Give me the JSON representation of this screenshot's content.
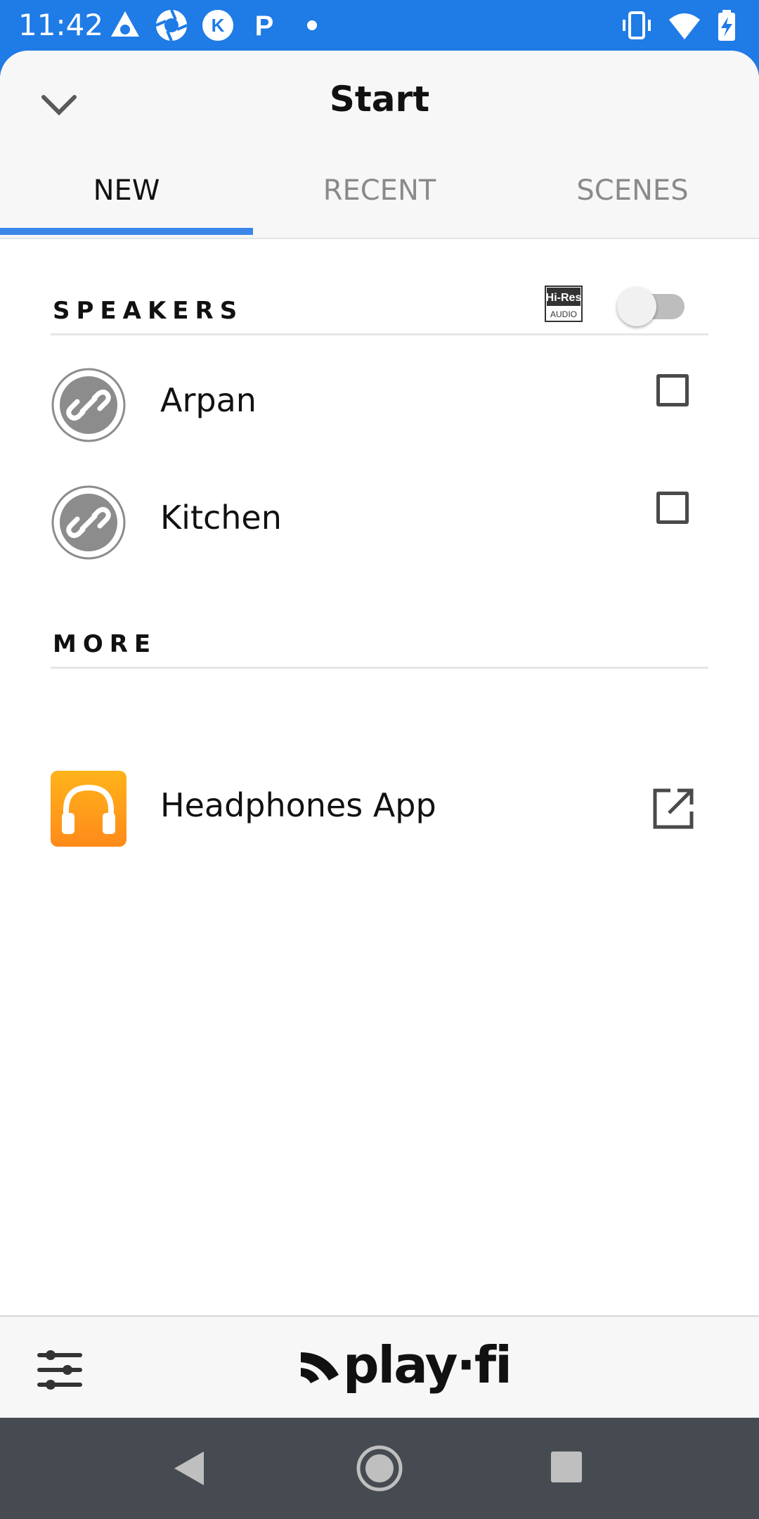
{
  "status_bar": {
    "time": "11:42",
    "left_icons": [
      "triangle-app-icon",
      "shutter-app-icon",
      "k-app-icon",
      "p-app-icon",
      "dot-notification-icon"
    ],
    "right_icons": [
      "vibrate-icon",
      "wifi-icon",
      "battery-charging-icon"
    ]
  },
  "header": {
    "title": "Start",
    "tabs": [
      {
        "label": "NEW",
        "active": true
      },
      {
        "label": "RECENT",
        "active": false
      },
      {
        "label": "SCENES",
        "active": false
      }
    ],
    "accent_color": "#3b86e8"
  },
  "speakers_section": {
    "label": "SPEAKERS",
    "hires_badge": {
      "line1": "Hi-Res",
      "line2": "AUDIO"
    },
    "hires_toggle_on": false,
    "items": [
      {
        "name": "Arpan",
        "checked": false,
        "icon": "link-icon"
      },
      {
        "name": "Kitchen",
        "checked": false,
        "icon": "link-icon"
      }
    ]
  },
  "more_section": {
    "label": "MORE",
    "items": [
      {
        "name": "Headphones App",
        "icon": "headphones-icon",
        "action_icon": "open-external-icon"
      }
    ]
  },
  "footer": {
    "logo_text": "play·fi",
    "settings_icon": "sliders-icon"
  },
  "nav_bar": {
    "buttons": [
      "back-icon",
      "home-icon",
      "recents-icon"
    ]
  }
}
